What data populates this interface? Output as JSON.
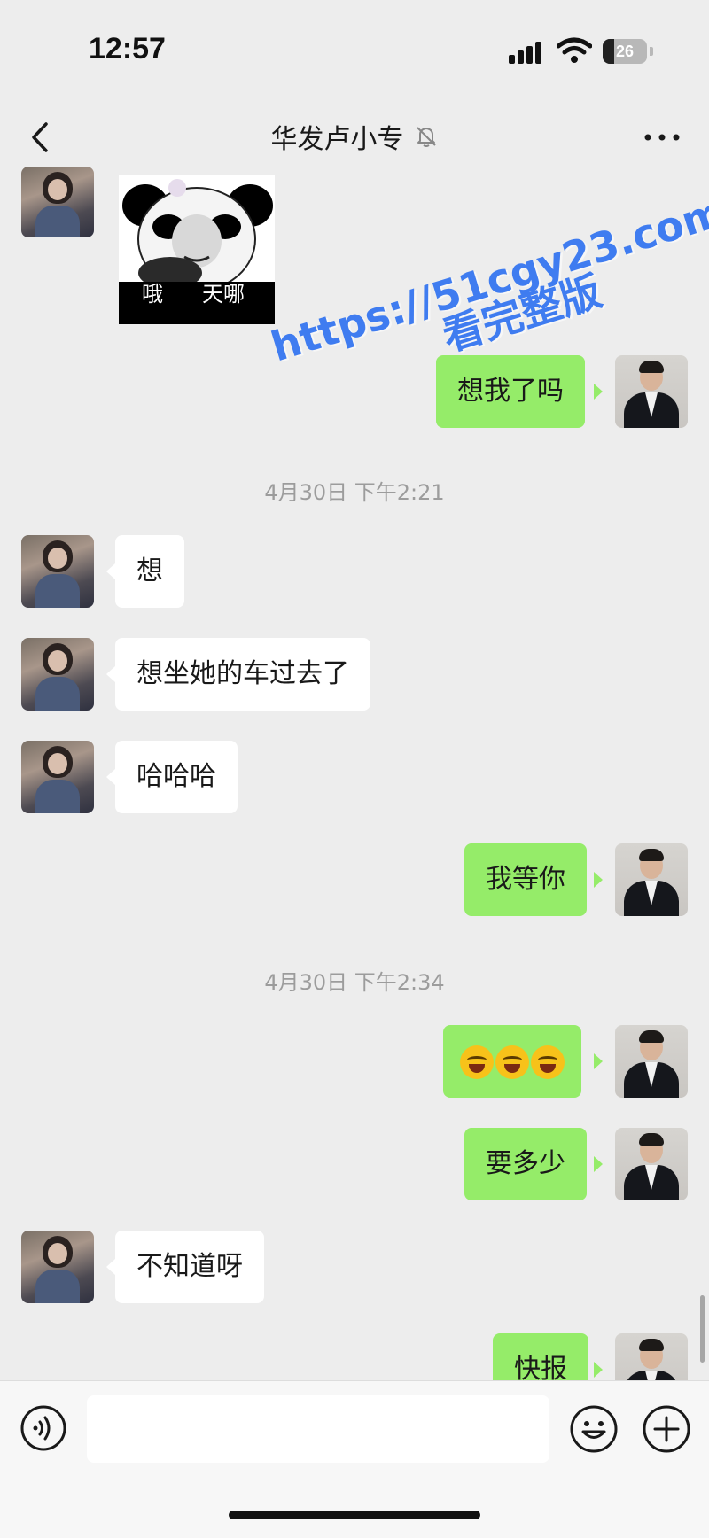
{
  "status_bar": {
    "time": "12:57",
    "battery": "26",
    "battery_level_percent": 26,
    "icons": [
      "signal-icon",
      "wifi-icon",
      "battery-icon"
    ]
  },
  "nav": {
    "title": "华发卢小专",
    "icons": [
      "chevron-left-icon",
      "bell-muted-icon",
      "more-dots-icon"
    ]
  },
  "colors": {
    "background": "#ededed",
    "outgoing_bubble": "#95ec69",
    "incoming_bubble": "#ffffff",
    "timestamp_text": "#9c9c9c",
    "watermark": "#3f7cf0"
  },
  "sticker": {
    "caption_left": "哦",
    "caption_right": "天哪"
  },
  "watermark": {
    "line1": "https://51cgy23.com",
    "line2": "看完整版"
  },
  "messages": [
    {
      "side": "right",
      "text": "想我了吗"
    },
    {
      "type": "timestamp",
      "text": "4月30日 下午2:21"
    },
    {
      "side": "left",
      "text": "想"
    },
    {
      "side": "left",
      "text": "想坐她的车过去了"
    },
    {
      "side": "left",
      "text": "哈哈哈"
    },
    {
      "side": "right",
      "text": "我等你"
    },
    {
      "type": "timestamp",
      "text": "4月30日 下午2:34"
    },
    {
      "side": "right",
      "emoji": "face-with-tears-of-joy",
      "count": 3
    },
    {
      "side": "right",
      "text": "要多少"
    },
    {
      "side": "left",
      "text": "不知道呀"
    },
    {
      "side": "right",
      "text": "快报"
    }
  ],
  "input_bar": {
    "value": "",
    "icons": [
      "voice-icon",
      "emoji-face-icon",
      "plus-icon"
    ]
  }
}
